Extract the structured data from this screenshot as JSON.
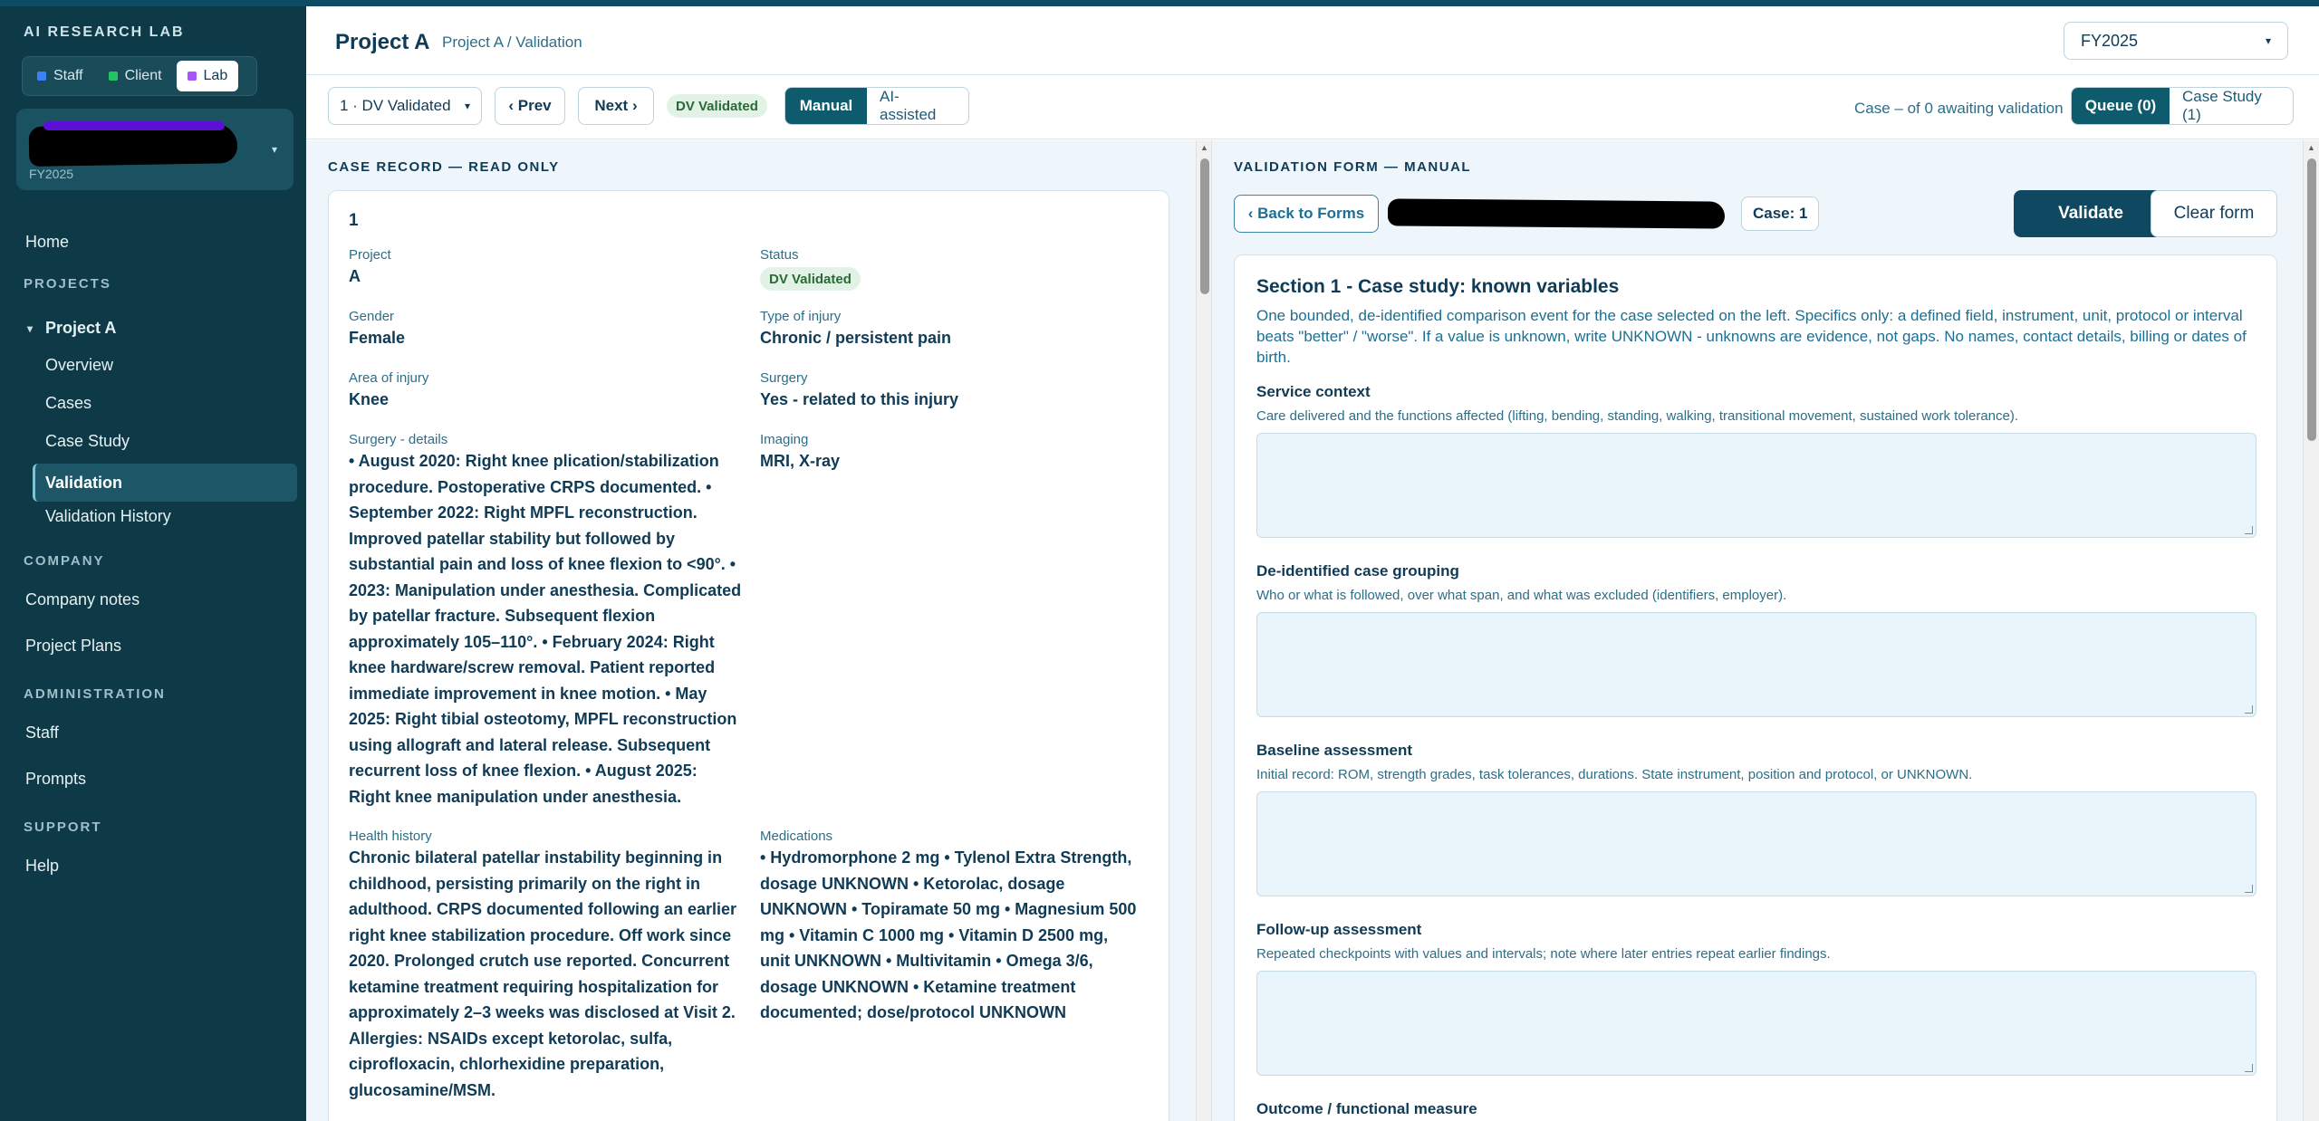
{
  "sidebar": {
    "brand": "AI RESEARCH LAB",
    "roles": [
      {
        "label": "Staff",
        "color": "#3b82f6"
      },
      {
        "label": "Client",
        "color": "#22c55e"
      },
      {
        "label": "Lab",
        "color": "#a855f7"
      }
    ],
    "account": {
      "fy": "FY2025"
    },
    "home": "Home",
    "projects_label": "PROJECTS",
    "project": "Project A",
    "project_items": [
      "Overview",
      "Cases",
      "Case Study",
      "Validation",
      "Validation History"
    ],
    "company_label": "COMPANY",
    "company_items": [
      "Company notes",
      "Project Plans"
    ],
    "admin_label": "ADMINISTRATION",
    "admin_items": [
      "Staff",
      "Prompts"
    ],
    "support_label": "SUPPORT",
    "support_items": [
      "Help"
    ]
  },
  "header": {
    "title": "Project A",
    "breadcrumb": "Project A / Validation",
    "fy_select": "FY2025"
  },
  "toolbar": {
    "case_select": "1 · DV Validated",
    "prev": "‹ Prev",
    "next": "Next ›",
    "badge": "DV Validated",
    "mode_manual": "Manual",
    "mode_ai": "AI-assisted",
    "status": "Case – of 0 awaiting validation",
    "queue": "Queue (0)",
    "case_study": "Case Study (1)"
  },
  "record": {
    "heading": "CASE RECORD — READ ONLY",
    "id": "1",
    "project_label": "Project",
    "project_value": "A",
    "status_label": "Status",
    "status_value": "DV Validated",
    "gender_label": "Gender",
    "gender_value": "Female",
    "injury_type_label": "Type of injury",
    "injury_type_value": "Chronic / persistent pain",
    "area_label": "Area of injury",
    "area_value": "Knee",
    "surgery_label": "Surgery",
    "surgery_value": "Yes - related to this injury",
    "surgery_details_label": "Surgery - details",
    "surgery_details_lines": [
      "• August 2020: Right knee plication/stabilization",
      "procedure. Postoperative CRPS documented. •",
      "September 2022: Right MPFL reconstruction.",
      "Improved patellar stability but followed by",
      "substantial pain and loss of knee flexion to <90°. •",
      "2023: Manipulation under anesthesia. Complicated",
      "by patellar fracture. Subsequent flexion",
      "approximately 105–110°. • February 2024: Right",
      "knee hardware/screw removal. Patient reported",
      "immediate improvement in knee motion. • May",
      "2025: Right tibial osteotomy, MPFL reconstruction",
      "using allograft and lateral release. Subsequent",
      "recurrent loss of knee flexion. • August 2025:",
      "Right knee manipulation under anesthesia."
    ],
    "imaging_label": "Imaging",
    "imaging_value": "MRI, X-ray",
    "health_label": "Health history",
    "health_lines": [
      "Chronic bilateral patellar instability beginning in",
      "childhood, persisting primarily on the right in",
      "adulthood. CRPS documented following an earlier",
      "right knee stabilization procedure. Off work since",
      "2020. Prolonged crutch use reported. Concurrent",
      "ketamine treatment requiring hospitalization for",
      "approximately 2–3 weeks was disclosed at Visit 2.",
      "Allergies: NSAIDs except ketorolac, sulfa,",
      "ciprofloxacin, chlorhexidine preparation,",
      "glucosamine/MSM."
    ],
    "meds_label": "Medications",
    "meds_lines": [
      "• Hydromorphone 2 mg • Tylenol Extra Strength,",
      "dosage UNKNOWN • Ketorolac, dosage",
      "UNKNOWN • Topiramate 50 mg • Magnesium 500",
      "mg • Vitamin C 1000 mg • Vitamin D 2500 mg,",
      "unit UNKNOWN • Multivitamin • Omega 3/6,",
      "dosage UNKNOWN • Ketamine treatment",
      "documented; dose/protocol UNKNOWN"
    ]
  },
  "form": {
    "heading": "VALIDATION FORM — MANUAL",
    "back": "‹ Back to Forms",
    "case_chip": "Case: 1",
    "validate": "Validate",
    "clear": "Clear form",
    "section_title": "Section 1 - Case study: known variables",
    "section_desc": "One bounded, de-identified comparison event for the case selected on the left. Specifics only: a defined field, instrument, unit, protocol or interval beats \"better\" / \"worse\". If a value is unknown, write UNKNOWN - unknowns are evidence, not gaps. No names, contact details, billing or dates of birth.",
    "questions": [
      {
        "label": "Service context",
        "help": "Care delivered and the functions affected (lifting, bending, standing, walking, transitional movement, sustained work tolerance)."
      },
      {
        "label": "De-identified case grouping",
        "help": "Who or what is followed, over what span, and what was excluded (identifiers, employer)."
      },
      {
        "label": "Baseline assessment",
        "help": "Initial record: ROM, strength grades, task tolerances, durations. State instrument, position and protocol, or UNKNOWN."
      },
      {
        "label": "Follow-up assessment",
        "help": "Repeated checkpoints with values and intervals; note where later entries repeat earlier findings."
      },
      {
        "label": "Outcome / functional measure",
        "help": ""
      }
    ]
  }
}
